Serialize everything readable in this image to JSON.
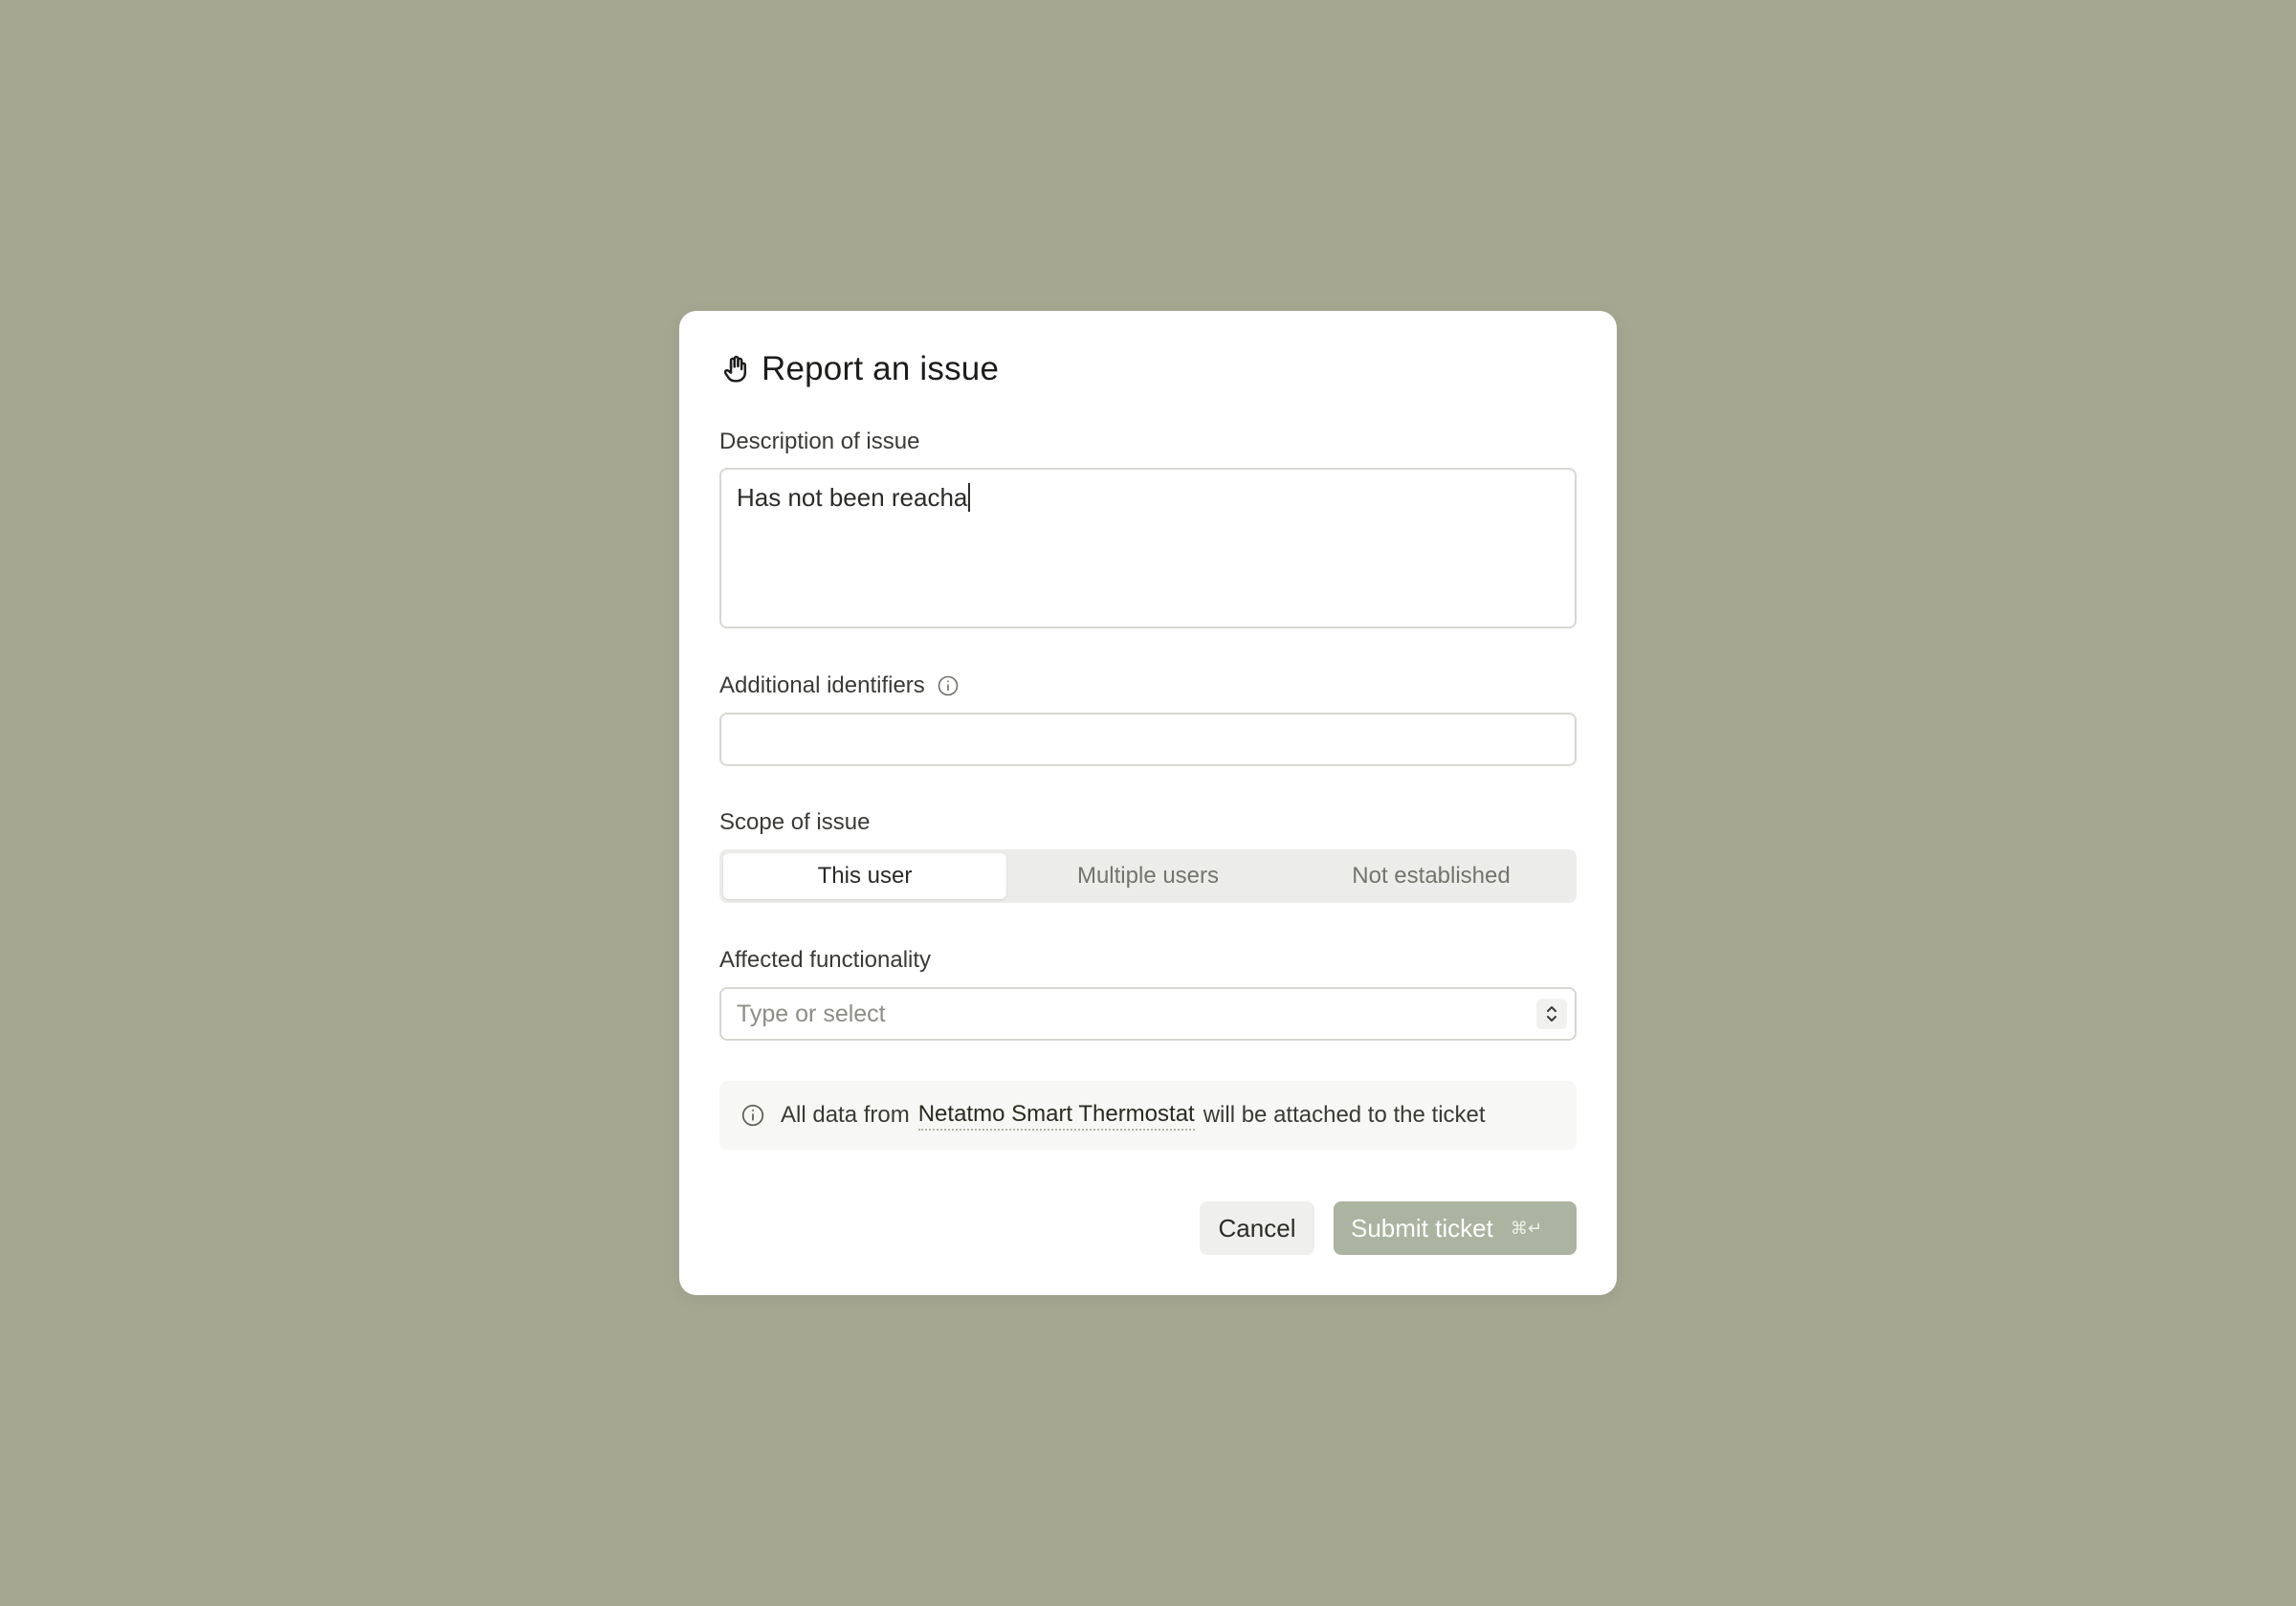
{
  "modal": {
    "title": "Report an issue",
    "title_icon": "hand-stop-icon"
  },
  "description": {
    "label": "Description of issue",
    "value": "Has not been reacha"
  },
  "identifiers": {
    "label": "Additional identifiers",
    "value": "",
    "info_icon": "info-icon"
  },
  "scope": {
    "label": "Scope of issue",
    "options": [
      "This user",
      "Multiple users",
      "Not established"
    ],
    "selected": "This user"
  },
  "functionality": {
    "label": "Affected functionality",
    "placeholder": "Type or select",
    "chevron_icon": "chevron-up-down-icon"
  },
  "notice": {
    "prefix": "All data from",
    "device": "Netatmo Smart Thermostat",
    "suffix": "will be attached to the ticket",
    "icon": "info-icon"
  },
  "actions": {
    "cancel_label": "Cancel",
    "submit_label": "Submit ticket",
    "submit_shortcut": "⌘↵"
  },
  "colors": {
    "backdrop": "#a6a791",
    "submit_bg": "#aab4a0",
    "modal_bg": "#ffffff"
  }
}
